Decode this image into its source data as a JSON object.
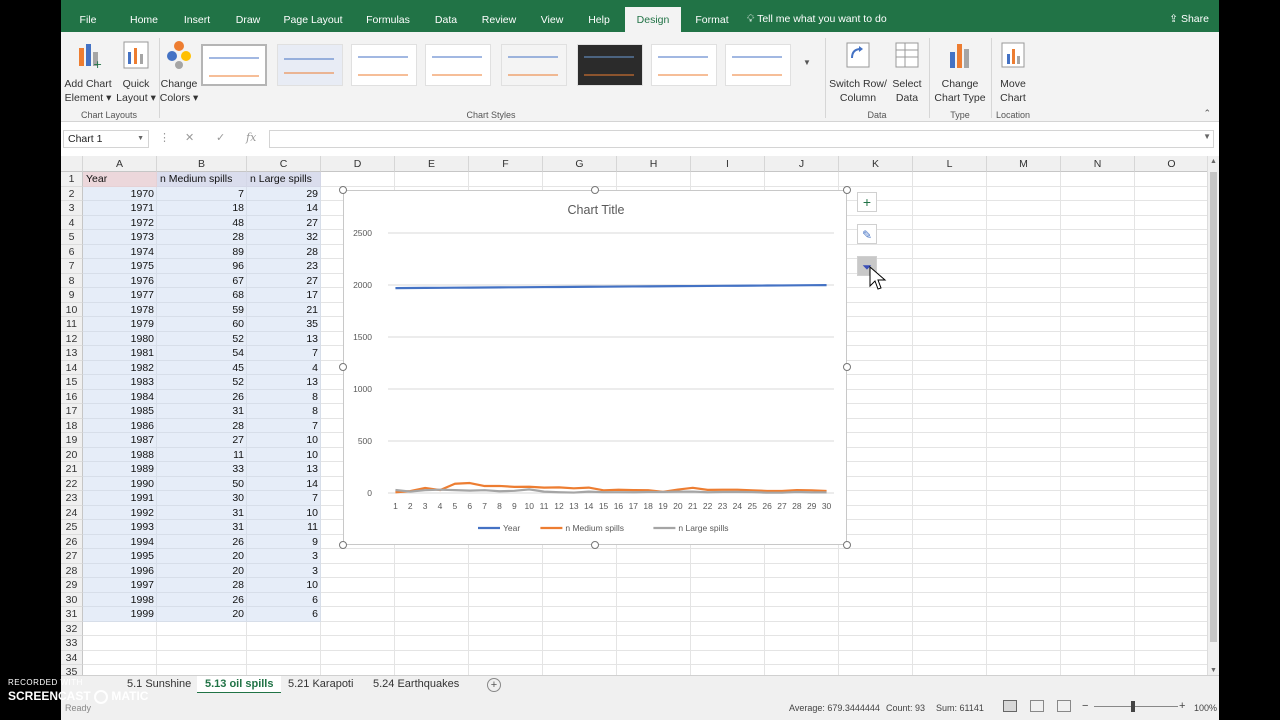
{
  "tabs": [
    {
      "label": "File"
    },
    {
      "label": "Home"
    },
    {
      "label": "Insert"
    },
    {
      "label": "Draw"
    },
    {
      "label": "Page Layout"
    },
    {
      "label": "Formulas"
    },
    {
      "label": "Data"
    },
    {
      "label": "Review"
    },
    {
      "label": "View"
    },
    {
      "label": "Help"
    },
    {
      "label": "Design",
      "active": true
    },
    {
      "label": "Format"
    }
  ],
  "tell_me": "Tell me what you want to do",
  "share": "Share",
  "ribbon": {
    "add_chart_element": [
      "Add Chart",
      "Element ▾"
    ],
    "quick_layout": [
      "Quick",
      "Layout ▾"
    ],
    "change_colors": [
      "Change",
      "Colors ▾"
    ],
    "switch_row_column": [
      "Switch Row/",
      "Column"
    ],
    "select_data": [
      "Select",
      "Data"
    ],
    "change_chart_type": [
      "Change",
      "Chart Type"
    ],
    "move_chart": [
      "Move",
      "Chart"
    ],
    "groups": {
      "chart_layouts": "Chart Layouts",
      "chart_styles": "Chart Styles",
      "data": "Data",
      "type": "Type",
      "location": "Location"
    }
  },
  "name_box": "Chart 1",
  "columns": [
    "A",
    "B",
    "C",
    "D",
    "E",
    "F",
    "G",
    "H",
    "I",
    "J",
    "K",
    "L",
    "M",
    "N",
    "O"
  ],
  "headers": [
    "Year",
    "n Medium spills",
    "n Large spills"
  ],
  "rows": [
    [
      1970,
      7,
      29
    ],
    [
      1971,
      18,
      14
    ],
    [
      1972,
      48,
      27
    ],
    [
      1973,
      28,
      32
    ],
    [
      1974,
      89,
      28
    ],
    [
      1975,
      96,
      23
    ],
    [
      1976,
      67,
      27
    ],
    [
      1977,
      68,
      17
    ],
    [
      1978,
      59,
      21
    ],
    [
      1979,
      60,
      35
    ],
    [
      1980,
      52,
      13
    ],
    [
      1981,
      54,
      7
    ],
    [
      1982,
      45,
      4
    ],
    [
      1983,
      52,
      13
    ],
    [
      1984,
      26,
      8
    ],
    [
      1985,
      31,
      8
    ],
    [
      1986,
      28,
      7
    ],
    [
      1987,
      27,
      10
    ],
    [
      1988,
      11,
      10
    ],
    [
      1989,
      33,
      13
    ],
    [
      1990,
      50,
      14
    ],
    [
      1991,
      30,
      7
    ],
    [
      1992,
      31,
      10
    ],
    [
      1993,
      31,
      11
    ],
    [
      1994,
      26,
      9
    ],
    [
      1995,
      20,
      3
    ],
    [
      1996,
      20,
      3
    ],
    [
      1997,
      28,
      10
    ],
    [
      1998,
      26,
      6
    ],
    [
      1999,
      20,
      6
    ]
  ],
  "row_numbers": [
    1,
    2,
    3,
    4,
    5,
    6,
    7,
    8,
    9,
    10,
    11,
    12,
    13,
    14,
    15,
    16,
    17,
    18,
    19,
    20,
    21,
    22,
    23,
    24,
    25,
    26,
    27,
    28,
    29,
    30,
    31,
    32,
    33,
    34,
    35
  ],
  "chart_data": {
    "type": "line",
    "title": "Chart Title",
    "categories": [
      1,
      2,
      3,
      4,
      5,
      6,
      7,
      8,
      9,
      10,
      11,
      12,
      13,
      14,
      15,
      16,
      17,
      18,
      19,
      20,
      21,
      22,
      23,
      24,
      25,
      26,
      27,
      28,
      29,
      30
    ],
    "ylim": [
      0,
      2500
    ],
    "yticks": [
      0,
      500,
      1000,
      1500,
      2000,
      2500
    ],
    "grid": true,
    "legend": "bottom",
    "series": [
      {
        "name": "Year",
        "color": "#4472c4",
        "values": [
          1970,
          1971,
          1972,
          1973,
          1974,
          1975,
          1976,
          1977,
          1978,
          1979,
          1980,
          1981,
          1982,
          1983,
          1984,
          1985,
          1986,
          1987,
          1988,
          1989,
          1990,
          1991,
          1992,
          1993,
          1994,
          1995,
          1996,
          1997,
          1998,
          1999
        ]
      },
      {
        "name": "n Medium spills",
        "color": "#ed7d31",
        "values": [
          7,
          18,
          48,
          28,
          89,
          96,
          67,
          68,
          59,
          60,
          52,
          54,
          45,
          52,
          26,
          31,
          28,
          27,
          11,
          33,
          50,
          30,
          31,
          31,
          26,
          20,
          20,
          28,
          26,
          20
        ]
      },
      {
        "name": "n Large spills",
        "color": "#a5a5a5",
        "values": [
          29,
          14,
          27,
          32,
          28,
          23,
          27,
          17,
          21,
          35,
          13,
          7,
          4,
          13,
          8,
          8,
          7,
          10,
          10,
          13,
          14,
          7,
          10,
          11,
          9,
          3,
          3,
          10,
          6,
          6
        ]
      }
    ]
  },
  "sheets": [
    {
      "label": "5.1 Sunshine"
    },
    {
      "label": "5.13 oil spills",
      "active": true
    },
    {
      "label": "5.21 Karapoti"
    },
    {
      "label": "5.24 Earthquakes"
    }
  ],
  "status": {
    "average": "Average: 679.3444444",
    "count": "Count: 93",
    "sum": "Sum: 61141",
    "zoom": "100%",
    "ready": "Ready"
  },
  "watermark": {
    "line1": "RECORDED WITH",
    "line2": "SCREENCAST",
    "line3": "MATIC"
  }
}
